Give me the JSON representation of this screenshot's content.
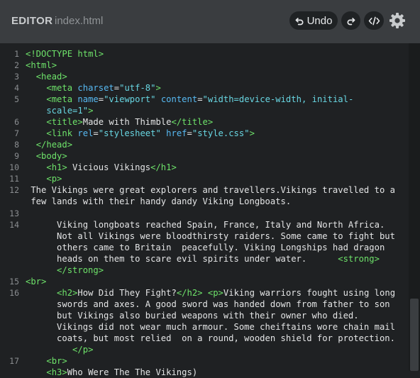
{
  "header": {
    "title": "EDITOR",
    "filename": "index.html",
    "undo_label": "Undo",
    "icons": {
      "undo": "undo-arrow-icon",
      "redo": "redo-arrow-icon",
      "code": "code-brackets-icon",
      "settings": "gear-icon"
    }
  },
  "colors": {
    "header_bg": "#3a3d40",
    "editor_bg": "#1f2123",
    "tag": "#6ee36a",
    "attribute": "#57b9f2",
    "string": "#68d6e2",
    "text": "#e4e5e6"
  },
  "editor": {
    "line_numbers": [
      "1",
      "2",
      "3",
      "4",
      "5",
      "6",
      "7",
      "8",
      "9",
      "10",
      "11",
      "12",
      "13",
      "14",
      "15",
      "16",
      "17"
    ],
    "lines": [
      "<!DOCTYPE html>",
      "<html>",
      "  <head>",
      "    <meta charset=\"utf-8\">",
      "    <meta name=\"viewport\" content=\"width=device-width, initial-",
      "    scale=1\">",
      "    <title>Made with Thimble</title>",
      "    <link rel=\"stylesheet\" href=\"style.css\">",
      "  </head>",
      "  <body>",
      "    <h1> Vicious Vikings</h1>",
      "    <p>",
      " The Vikings were great explorers and travellers.Vikings travelled to a",
      " few lands with their handy dandy Viking Longboats.",
      "      Viking longboats reached Spain, France, Italy and North Africa.",
      "      Not all Vikings were bloodthirsty raiders. Some came to fight but",
      "      others came to Britain  peacefully. Viking Longships had dragon",
      "      heads on them to scare evil spirits under water.      <strong>",
      "      </strong>",
      "<br>",
      "      <h2>How Did They Fight?</h2> <p>Viking warriors fought using long",
      "      swords and axes. A good sword was handed down from father to son",
      "      but Vikings also buried weapons with their owner who died.",
      "      Vikings did not wear much armour. Some cheiftains wore chain mail",
      "      coats, but most relied  on a round, wooden shield for protection.",
      "         </p>",
      "    <br>",
      "    <h3>Who Were The The Vikings)"
    ]
  }
}
